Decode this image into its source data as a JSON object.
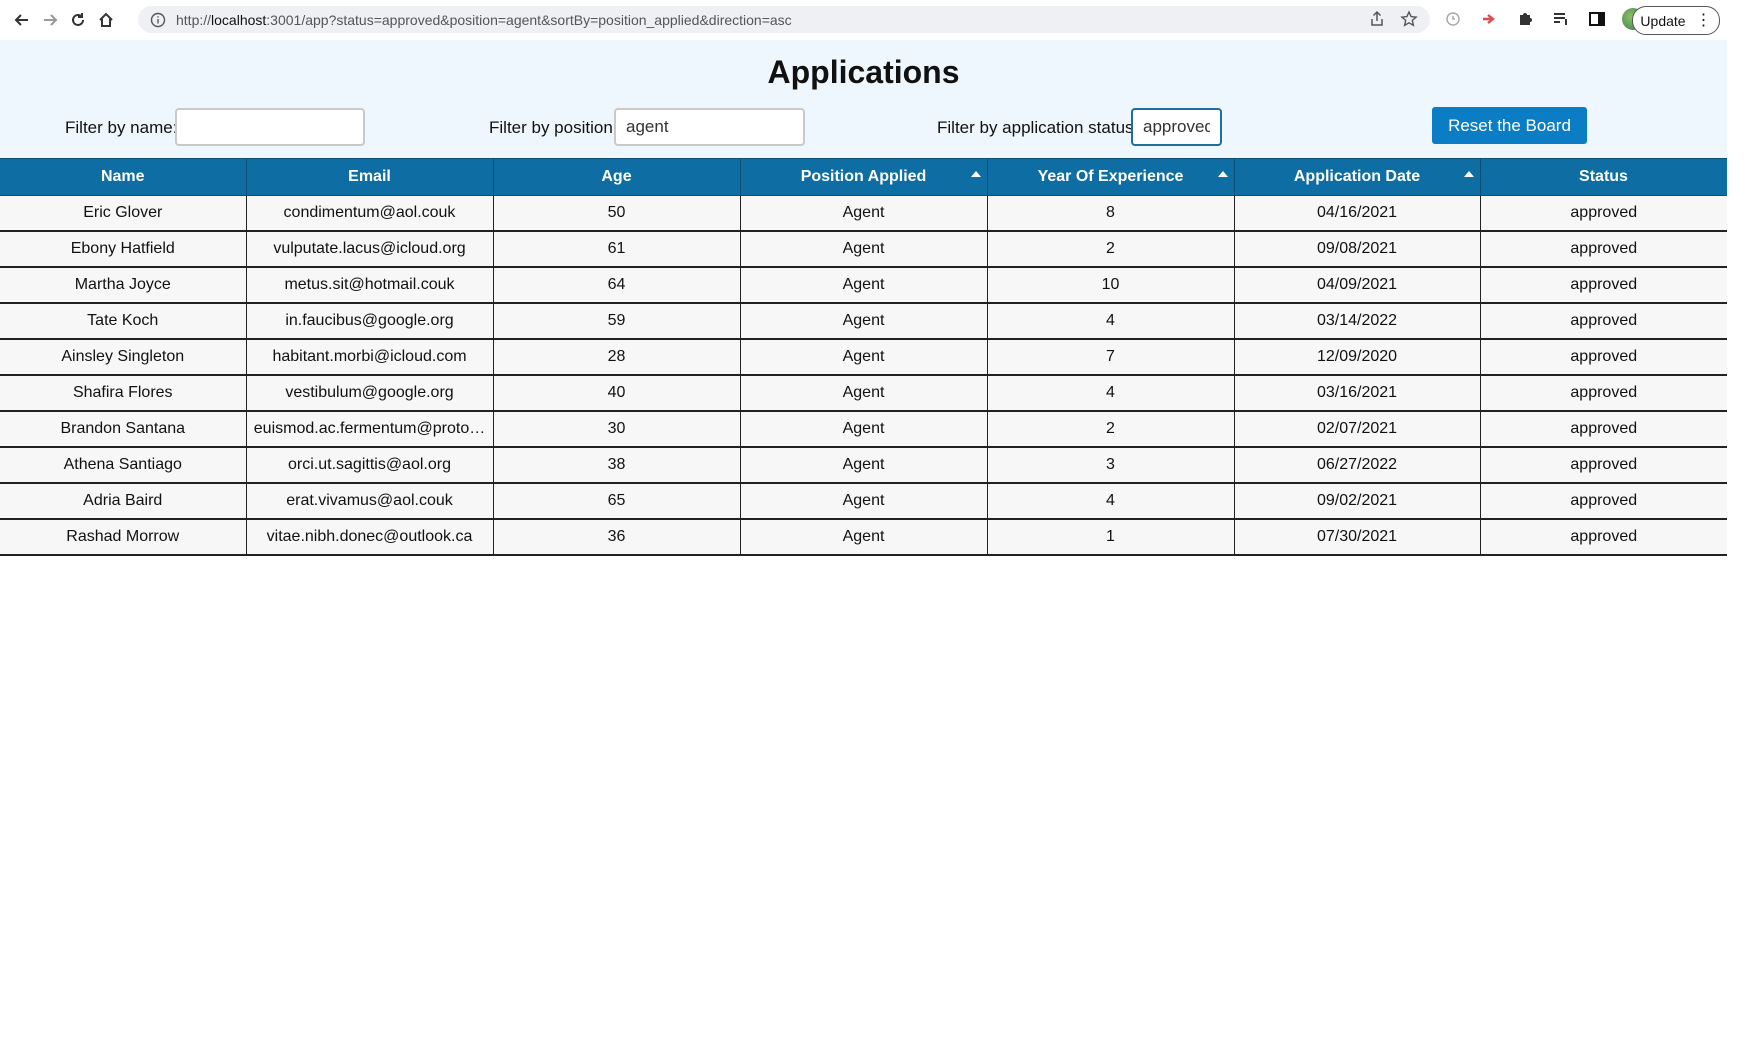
{
  "browser": {
    "url_prefix": "http://",
    "url_host": "localhost",
    "url_rest": ":3001/app?status=approved&position=agent&sortBy=position_applied&direction=asc",
    "update_label": "Update"
  },
  "page": {
    "title": "Applications"
  },
  "filters": {
    "name_label": "Filter by name:",
    "name_value": "",
    "position_label": "Filter by position:",
    "position_value": "agent",
    "status_label": "Filter by application status:",
    "status_value": "approved",
    "reset_label": "Reset the Board"
  },
  "table": {
    "columns": [
      "Name",
      "Email",
      "Age",
      "Position Applied",
      "Year Of Experience",
      "Application Date",
      "Status"
    ],
    "rows": [
      [
        "Eric Glover",
        "condimentum@aol.couk",
        "50",
        "Agent",
        "8",
        "04/16/2021",
        "approved"
      ],
      [
        "Ebony Hatfield",
        "vulputate.lacus@icloud.org",
        "61",
        "Agent",
        "2",
        "09/08/2021",
        "approved"
      ],
      [
        "Martha Joyce",
        "metus.sit@hotmail.couk",
        "64",
        "Agent",
        "10",
        "04/09/2021",
        "approved"
      ],
      [
        "Tate Koch",
        "in.faucibus@google.org",
        "59",
        "Agent",
        "4",
        "03/14/2022",
        "approved"
      ],
      [
        "Ainsley Singleton",
        "habitant.morbi@icloud.com",
        "28",
        "Agent",
        "7",
        "12/09/2020",
        "approved"
      ],
      [
        "Shafira Flores",
        "vestibulum@google.org",
        "40",
        "Agent",
        "4",
        "03/16/2021",
        "approved"
      ],
      [
        "Brandon Santana",
        "euismod.ac.fermentum@proto…",
        "30",
        "Agent",
        "2",
        "02/07/2021",
        "approved"
      ],
      [
        "Athena Santiago",
        "orci.ut.sagittis@aol.org",
        "38",
        "Agent",
        "3",
        "06/27/2022",
        "approved"
      ],
      [
        "Adria Baird",
        "erat.vivamus@aol.couk",
        "65",
        "Agent",
        "4",
        "09/02/2021",
        "approved"
      ],
      [
        "Rashad Morrow",
        "vitae.nibh.donec@outlook.ca",
        "36",
        "Agent",
        "1",
        "07/30/2021",
        "approved"
      ]
    ]
  }
}
